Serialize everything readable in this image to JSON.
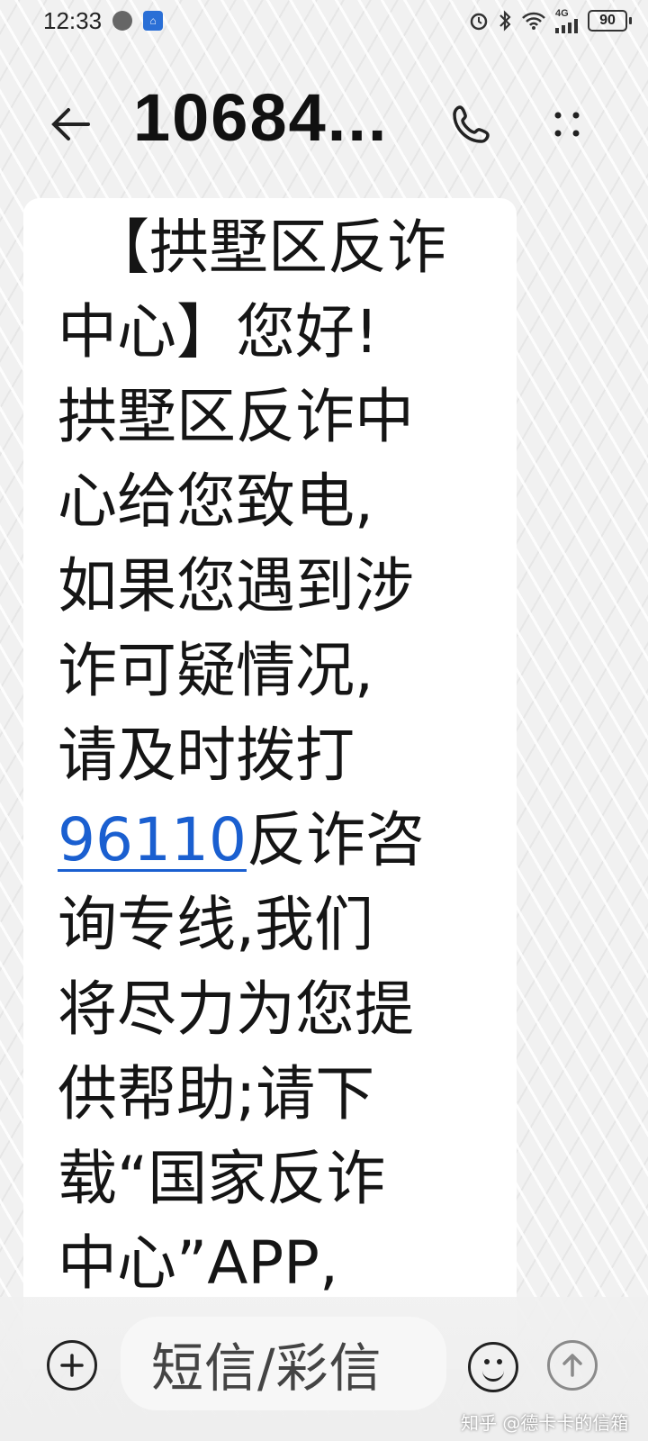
{
  "status_bar": {
    "time": "12:33",
    "network_label": "4G",
    "battery": "90",
    "icons": [
      "voice-icon",
      "app-icon",
      "alarm-icon",
      "bluetooth-icon",
      "wifi-icon",
      "signal-icon",
      "battery-icon"
    ]
  },
  "header": {
    "title": "10684...",
    "icons": [
      "back-arrow-icon",
      "phone-icon",
      "more-dots-icon"
    ]
  },
  "message": {
    "lines": [
      "【拱墅区反诈",
      "中心】您好!",
      "拱墅区反诈中",
      "心给您致电,",
      "如果您遇到涉",
      "诈可疑情况,",
      "请及时拨打",
      "反诈咨",
      "询专线,我们",
      "将尽力为您提",
      "供帮助;请下",
      "载“国家反诈",
      "中心”APP,"
    ],
    "phone_number": "96110"
  },
  "input_bar": {
    "placeholder": "短信/彩信",
    "icons": [
      "add-icon",
      "emoji-icon",
      "send-icon"
    ]
  },
  "watermark": "知乎 @德卡卡的信箱",
  "colors": {
    "link": "#1a5fd0",
    "bubble": "#ffffff",
    "background": "#f1f1f1"
  }
}
